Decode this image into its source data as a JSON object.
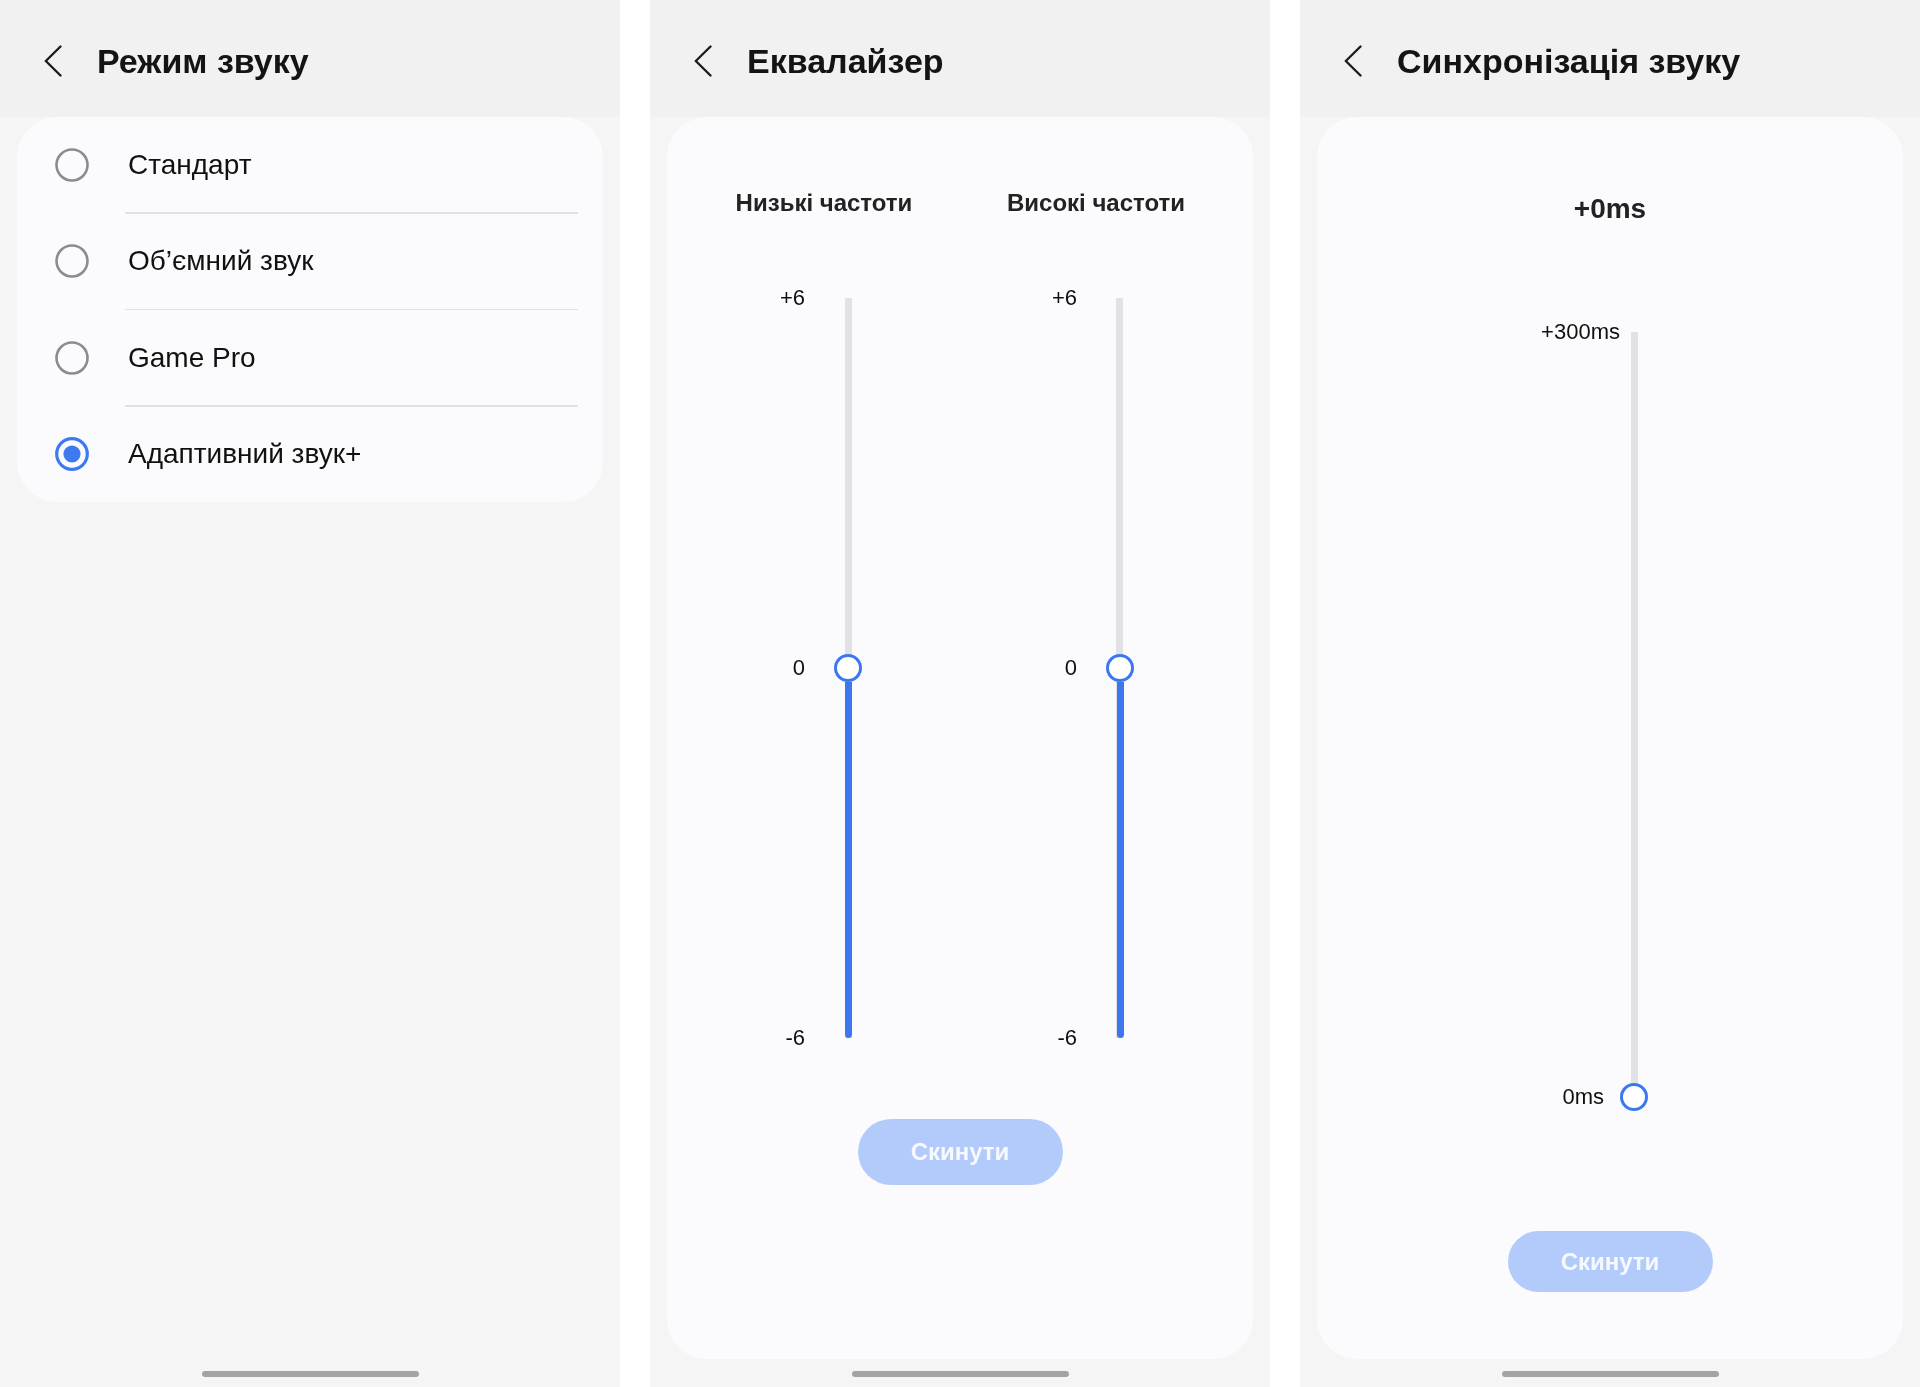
{
  "screens": [
    {
      "kind": "options",
      "title": "Режим звуку",
      "options": [
        {
          "label": "Стандарт",
          "selected": false
        },
        {
          "label": "Об’ємний звук",
          "selected": false
        },
        {
          "label": "Game Pro",
          "selected": false
        },
        {
          "label": "Адаптивний звук+",
          "selected": true
        }
      ]
    },
    {
      "kind": "equalizer",
      "title": "Еквалайзер",
      "bands": [
        {
          "label": "Низькі частоти",
          "max_label": "+6",
          "mid_label": "0",
          "min_label": "-6",
          "level": 0.5
        },
        {
          "label": "Високі частоти",
          "max_label": "+6",
          "mid_label": "0",
          "min_label": "-6",
          "level": 0.5
        }
      ],
      "reset_button": {
        "label": "Скинути",
        "disabled": true
      }
    },
    {
      "kind": "delay",
      "title": "Синхронізація звуку",
      "value": "+0ms",
      "slider": {
        "max_label": "+300ms",
        "min_label": "0ms",
        "level": 0
      },
      "reset_button": {
        "label": "Скинути",
        "disabled": true
      }
    }
  ]
}
